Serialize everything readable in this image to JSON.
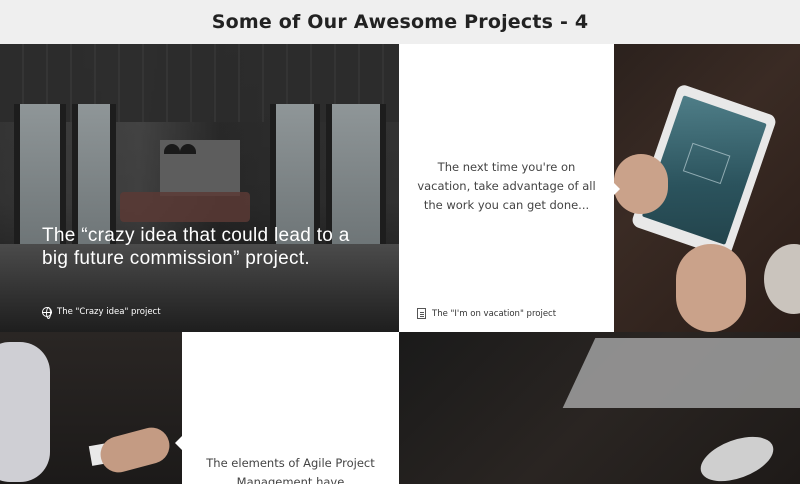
{
  "header": {
    "title": "Some of Our Awesome Projects - 4"
  },
  "tiles": {
    "office": {
      "caption": "The “crazy idea that could lead to a big future commission” project.",
      "footer_label": "The \"Crazy idea\" project",
      "icon": "globe-icon"
    },
    "vacation_card": {
      "text": "The next time you're on vacation, take advantage of all the work you can get done...",
      "footer_label": "The \"I'm on vacation\" project",
      "icon": "document-icon"
    },
    "agile_card": {
      "text": "The elements of Agile Project Management have"
    }
  },
  "colors": {
    "page_background": "#efefef",
    "card_background": "#ffffff",
    "title_text": "#222222"
  }
}
